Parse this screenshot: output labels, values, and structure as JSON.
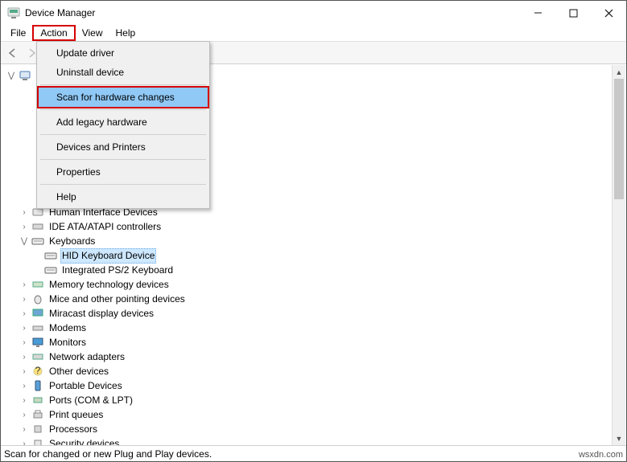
{
  "title_bar": {
    "title": "Device Manager"
  },
  "menu_bar": {
    "file": "File",
    "action": "Action",
    "view": "View",
    "help": "Help"
  },
  "dropdown": {
    "update_driver": "Update driver",
    "uninstall_device": "Uninstall device",
    "scan_hw": "Scan for hardware changes",
    "add_legacy": "Add legacy hardware",
    "devices_printers": "Devices and Printers",
    "properties": "Properties",
    "help": "Help"
  },
  "tree": {
    "root": "",
    "hid": "Human Interface Devices",
    "ide": "IDE ATA/ATAPI controllers",
    "keyboards": "Keyboards",
    "hid_keyboard": "HID Keyboard Device",
    "ps2_keyboard": "Integrated PS/2 Keyboard",
    "memtech": "Memory technology devices",
    "mice": "Mice and other pointing devices",
    "miracast": "Miracast display devices",
    "modems": "Modems",
    "monitors": "Monitors",
    "network": "Network adapters",
    "other": "Other devices",
    "portable": "Portable Devices",
    "ports": "Ports (COM & LPT)",
    "print_queues": "Print queues",
    "processors": "Processors",
    "security": "Security devices"
  },
  "status_bar": {
    "text": "Scan for changed or new Plug and Play devices."
  },
  "watermark": "wsxdn.com"
}
